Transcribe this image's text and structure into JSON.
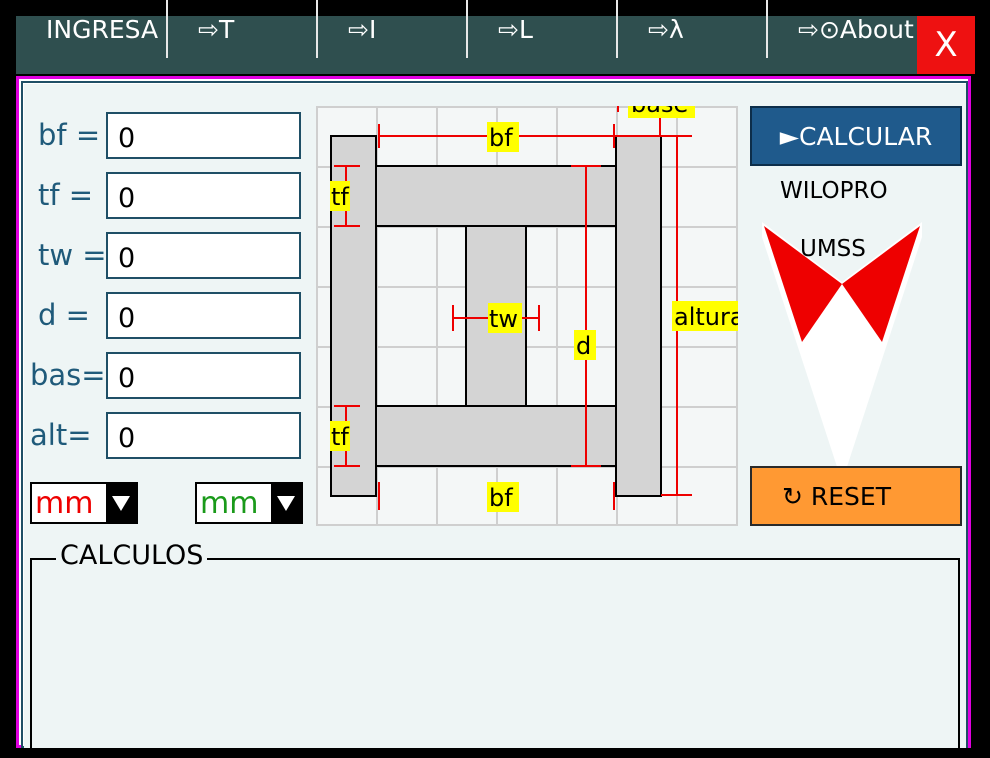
{
  "tabs": [
    {
      "label": "INGRESA"
    },
    {
      "label": "⇨T"
    },
    {
      "label": "⇨I"
    },
    {
      "label": "⇨L"
    },
    {
      "label": "⇨λ"
    },
    {
      "label": "⇨⊙About"
    }
  ],
  "close_label": "X",
  "form": {
    "fields": [
      {
        "label": "bf =",
        "value": "0"
      },
      {
        "label": "tf =",
        "value": "0"
      },
      {
        "label": "tw =",
        "value": "0"
      },
      {
        "label": "d =",
        "value": "0"
      },
      {
        "label": "bas=",
        "value": "0"
      },
      {
        "label": "alt=",
        "value": "0"
      }
    ],
    "unit_in": "mm",
    "unit_out": "mm"
  },
  "diagram": {
    "labels": {
      "base": "base",
      "bf_top": "bf",
      "bf_bottom": "bf",
      "tf_top": "tf",
      "tf_bottom": "tf",
      "tw": "tw",
      "d": "d",
      "altura": "altura"
    }
  },
  "buttons": {
    "calcular": "►CALCULAR",
    "reset": "↻ RESET"
  },
  "logo": {
    "line1": "WILOPRO",
    "line2": "UMSS"
  },
  "section": {
    "calculos": "CALCULOS"
  },
  "colors": {
    "tabbar": "#2f4f4f",
    "close": "#ee1111",
    "frame_magenta": "#e000e0",
    "panel": "#eef5f5",
    "calcular": "#1f5a8c",
    "reset": "#ff9933",
    "dimension": "#ee0000",
    "label_highlight": "#ffff00",
    "unit_in_text": "#ee0000",
    "unit_out_text": "#1a9a1a"
  }
}
